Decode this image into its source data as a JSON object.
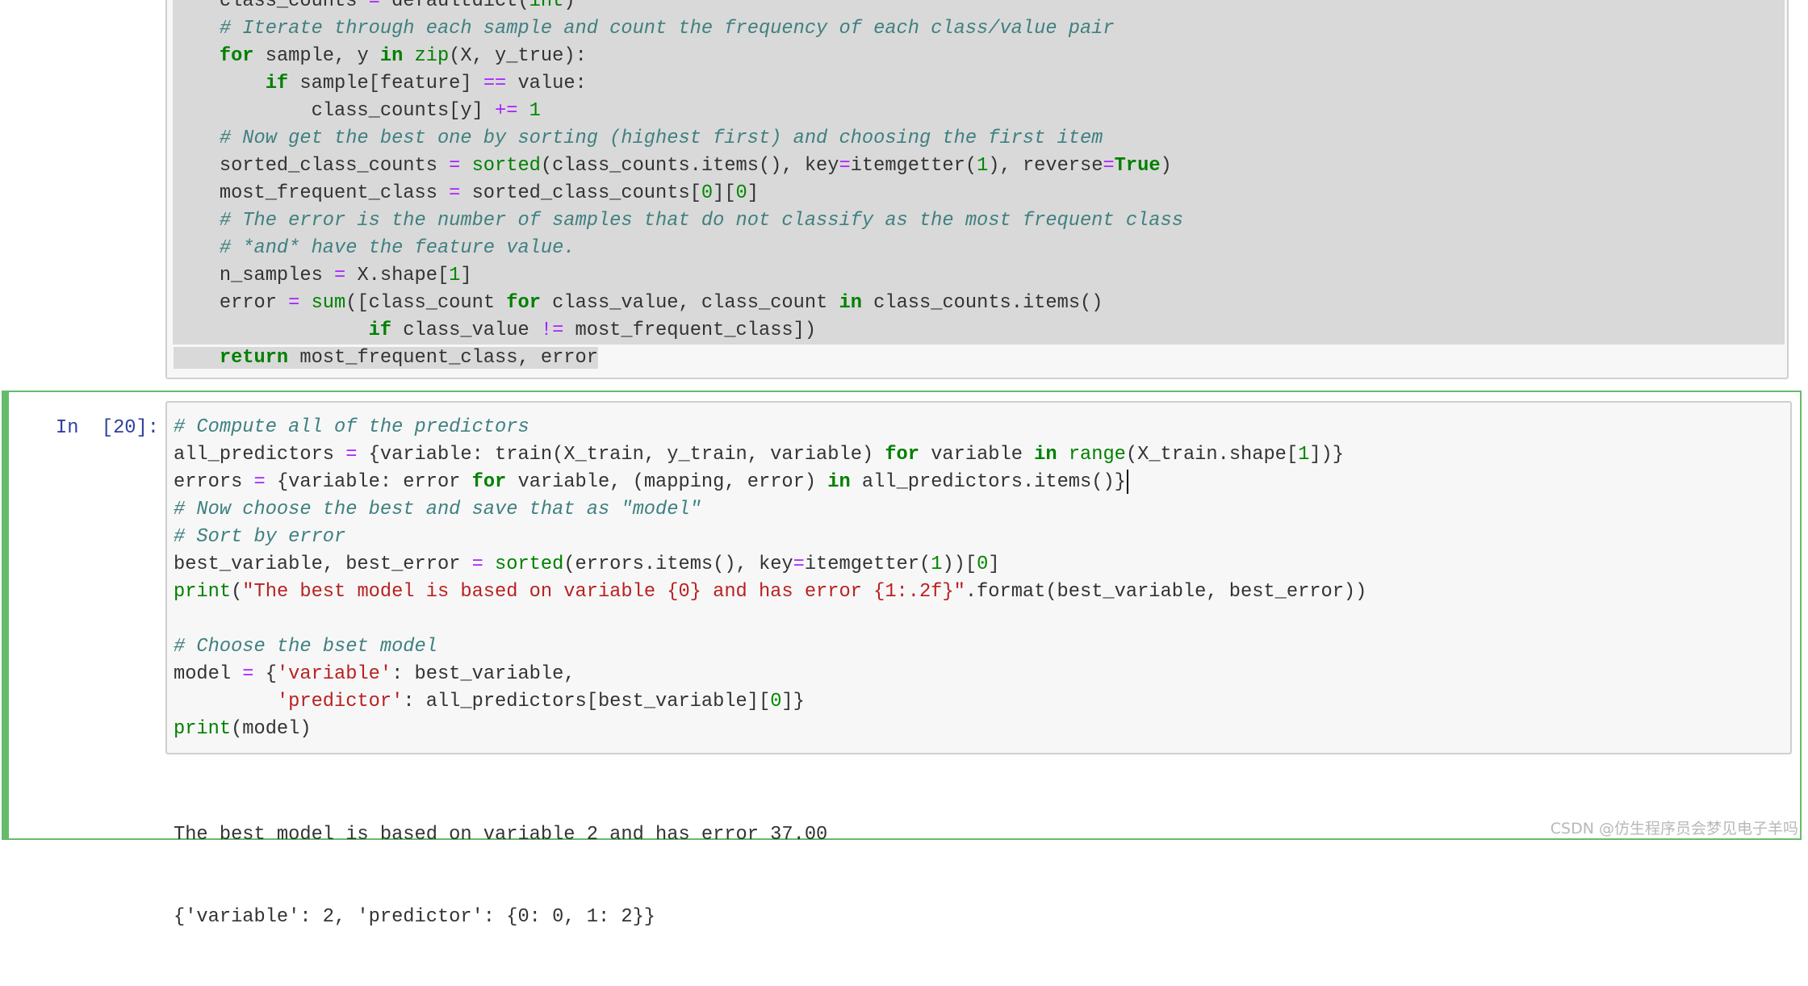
{
  "colors": {
    "keyword": "#008000",
    "comment": "#408080",
    "operator": "#aa22ff",
    "string": "#ba2121",
    "prompt": "#303f9f",
    "selected_cell_border": "#66bb6a"
  },
  "top_cell": {
    "lines": [
      [
        [
          "p",
          "    class_counts "
        ],
        [
          "o",
          "="
        ],
        [
          "p",
          " defaultdict("
        ],
        [
          "b",
          "int"
        ],
        [
          "p",
          ")"
        ]
      ],
      [
        [
          "p",
          "    "
        ],
        [
          "c",
          "# Iterate through each sample and count the frequency of each class/value pair"
        ]
      ],
      [
        [
          "p",
          "    "
        ],
        [
          "k",
          "for"
        ],
        [
          "p",
          " sample, y "
        ],
        [
          "k",
          "in"
        ],
        [
          "p",
          " "
        ],
        [
          "b",
          "zip"
        ],
        [
          "p",
          "(X, y_true):"
        ]
      ],
      [
        [
          "p",
          "        "
        ],
        [
          "k",
          "if"
        ],
        [
          "p",
          " sample[feature] "
        ],
        [
          "o",
          "=="
        ],
        [
          "p",
          " value:"
        ]
      ],
      [
        [
          "p",
          "            class_counts[y] "
        ],
        [
          "o",
          "+="
        ],
        [
          "p",
          " "
        ],
        [
          "n",
          "1"
        ]
      ],
      [
        [
          "p",
          "    "
        ],
        [
          "c",
          "# Now get the best one by sorting (highest first) and choosing the first item"
        ]
      ],
      [
        [
          "p",
          "    sorted_class_counts "
        ],
        [
          "o",
          "="
        ],
        [
          "p",
          " "
        ],
        [
          "b",
          "sorted"
        ],
        [
          "p",
          "(class_counts.items(), key"
        ],
        [
          "o",
          "="
        ],
        [
          "p",
          "itemgetter("
        ],
        [
          "n",
          "1"
        ],
        [
          "p",
          "), reverse"
        ],
        [
          "o",
          "="
        ],
        [
          "k",
          "True"
        ],
        [
          "p",
          ")"
        ]
      ],
      [
        [
          "p",
          "    most_frequent_class "
        ],
        [
          "o",
          "="
        ],
        [
          "p",
          " sorted_class_counts["
        ],
        [
          "n",
          "0"
        ],
        [
          "p",
          "]["
        ],
        [
          "n",
          "0"
        ],
        [
          "p",
          "]"
        ]
      ],
      [
        [
          "p",
          "    "
        ],
        [
          "c",
          "# The error is the number of samples that do not classify as the most frequent class"
        ]
      ],
      [
        [
          "p",
          "    "
        ],
        [
          "c",
          "# *and* have the feature value."
        ]
      ],
      [
        [
          "p",
          "    n_samples "
        ],
        [
          "o",
          "="
        ],
        [
          "p",
          " X.shape["
        ],
        [
          "n",
          "1"
        ],
        [
          "p",
          "]"
        ]
      ],
      [
        [
          "p",
          "    error "
        ],
        [
          "o",
          "="
        ],
        [
          "p",
          " "
        ],
        [
          "b",
          "sum"
        ],
        [
          "p",
          "([class_count "
        ],
        [
          "k",
          "for"
        ],
        [
          "p",
          " class_value, class_count "
        ],
        [
          "k",
          "in"
        ],
        [
          "p",
          " class_counts.items()"
        ]
      ],
      [
        [
          "p",
          "                 "
        ],
        [
          "k",
          "if"
        ],
        [
          "p",
          " class_value "
        ],
        [
          "o",
          "!="
        ],
        [
          "p",
          " most_frequent_class])"
        ]
      ],
      [
        [
          "p",
          "    "
        ],
        [
          "k",
          "return"
        ],
        [
          "p",
          " most_frequent_class, error"
        ]
      ]
    ]
  },
  "active_cell": {
    "prompt": "In  [20]:",
    "lines": [
      [
        [
          "c",
          "# Compute all of the predictors"
        ]
      ],
      [
        [
          "p",
          "all_predictors "
        ],
        [
          "o",
          "="
        ],
        [
          "p",
          " {variable: train(X_train, y_train, variable) "
        ],
        [
          "k",
          "for"
        ],
        [
          "p",
          " variable "
        ],
        [
          "k",
          "in"
        ],
        [
          "p",
          " "
        ],
        [
          "b",
          "range"
        ],
        [
          "p",
          "(X_train.shape["
        ],
        [
          "n",
          "1"
        ],
        [
          "p",
          "])}"
        ]
      ],
      [
        [
          "p",
          "errors "
        ],
        [
          "o",
          "="
        ],
        [
          "p",
          " {variable: error "
        ],
        [
          "k",
          "for"
        ],
        [
          "p",
          " variable, (mapping, error) "
        ],
        [
          "k",
          "in"
        ],
        [
          "p",
          " all_predictors.items()}"
        ]
      ],
      [
        [
          "c",
          "# Now choose the best and save that as \"model\""
        ]
      ],
      [
        [
          "c",
          "# Sort by error"
        ]
      ],
      [
        [
          "p",
          "best_variable, best_error "
        ],
        [
          "o",
          "="
        ],
        [
          "p",
          " "
        ],
        [
          "b",
          "sorted"
        ],
        [
          "p",
          "(errors.items(), key"
        ],
        [
          "o",
          "="
        ],
        [
          "p",
          "itemgetter("
        ],
        [
          "n",
          "1"
        ],
        [
          "p",
          "))["
        ],
        [
          "n",
          "0"
        ],
        [
          "p",
          "]"
        ]
      ],
      [
        [
          "b",
          "print"
        ],
        [
          "p",
          "("
        ],
        [
          "s",
          "\"The best model is based on variable {0} and has error {1:.2f}\""
        ],
        [
          "p",
          ".format(best_variable, best_error))"
        ]
      ],
      [],
      [
        [
          "c",
          "# Choose the bset model"
        ]
      ],
      [
        [
          "p",
          "model "
        ],
        [
          "o",
          "="
        ],
        [
          "p",
          " {"
        ],
        [
          "s",
          "'variable'"
        ],
        [
          "p",
          ": best_variable,"
        ]
      ],
      [
        [
          "p",
          "         "
        ],
        [
          "s",
          "'predictor'"
        ],
        [
          "p",
          ": all_predictors[best_variable]["
        ],
        [
          "n",
          "0"
        ],
        [
          "p",
          "]}"
        ]
      ],
      [
        [
          "b",
          "print"
        ],
        [
          "p",
          "(model)"
        ]
      ]
    ],
    "output": [
      "The best model is based on variable 2 and has error 37.00",
      "{'variable': 2, 'predictor': {0: 0, 1: 2}}"
    ]
  },
  "watermark": "CSDN @仿生程序员会梦见电子羊吗"
}
